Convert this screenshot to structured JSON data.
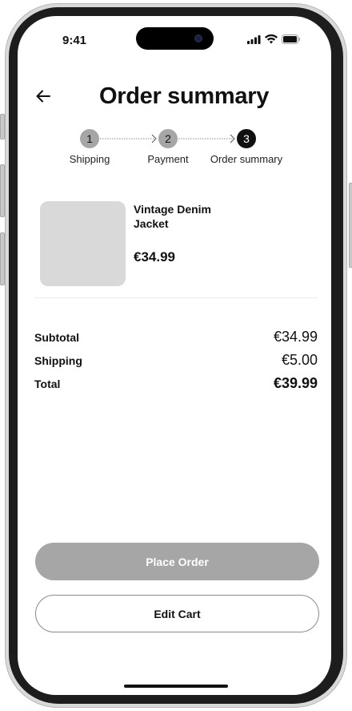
{
  "status_bar": {
    "time": "9:41",
    "icons": [
      "signal-icon",
      "wifi-icon",
      "battery-icon"
    ]
  },
  "header": {
    "back_icon": "arrow-left-icon",
    "title": "Order summary"
  },
  "stepper": {
    "steps": [
      {
        "number": "1",
        "label": "Shipping",
        "state": "done"
      },
      {
        "number": "2",
        "label": "Payment",
        "state": "done"
      },
      {
        "number": "3",
        "label": "Order summary",
        "state": "current"
      }
    ]
  },
  "product": {
    "name": "Vintage Denim Jacket",
    "price": "€34.99"
  },
  "summary": {
    "subtotal_label": "Subtotal",
    "subtotal_value": "€34.99",
    "shipping_label": "Shipping",
    "shipping_value": "€5.00",
    "total_label": "Total",
    "total_value": "€39.99"
  },
  "actions": {
    "place_order_label": "Place Order",
    "edit_cart_label": "Edit Cart"
  },
  "colors": {
    "primary_disabled": "#a6a6a6",
    "text": "#111111",
    "step_done": "#a6a6a6",
    "step_current": "#111111"
  }
}
